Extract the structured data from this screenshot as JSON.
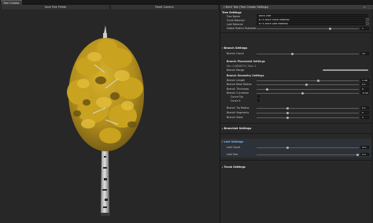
{
  "window": {
    "tab_title": "Tree Creator"
  },
  "viewport": {
    "save_button": "Save Tree Prefab",
    "reset_button": "Reset Camera"
  },
  "inspector": {
    "header_title": "Birch Tree (Tree Creator Settings)",
    "tree_settings": {
      "title": "Tree Settings",
      "tree_name_label": "Tree Name",
      "tree_name_value": "Birch Tree",
      "trunk_material_label": "Trunk Material",
      "trunk_material_value": "TS Birch Trunk Material",
      "leaf_material_label": "Leaf Material",
      "leaf_material_value": "TS Birch Leaf Material",
      "global_radius_label": "Global Radius Multiplier",
      "global_radius_value": "1"
    },
    "branch_settings": {
      "title": "Branch Settings",
      "branch_count_label": "Branch Count",
      "branch_count_value": "10",
      "placement_title": "Branch Placement Settings",
      "placement_info": "Min: 0.0838973 | Max: 1",
      "branch_range_label": "Branch Range",
      "geometry_title": "Branch Geometry Settings",
      "branch_length_label": "Branch Length",
      "branch_length_value": "1.46",
      "branch_base_radius_label": "Branch Base Radius",
      "branch_base_radius_value": "0.1",
      "branch_thickness_label": "Branch Thickness",
      "branch_thickness_value": "0",
      "branch_curvature_label": "Branch Curvature",
      "branch_curvature_value": "-0.093",
      "curve_flip_label": "Curve Flip",
      "curve_x_label": "Curve X",
      "branch_tip_radius_label": "Branch Tip Radius",
      "branch_tip_radius_value": "0.1",
      "branch_segments_label": "Branch Segments",
      "branch_segments_value": "5",
      "branch_sides_label": "Branch Sides",
      "branch_sides_value": "3"
    },
    "branchlet_settings": {
      "title": "Branchlet Settings"
    },
    "leaf_settings": {
      "title": "Leaf Settings",
      "leaf_count_label": "Leaf Count",
      "leaf_count_value": "311",
      "leaf_size_label": "Leaf Size",
      "leaf_size_value": "0.5"
    },
    "trunk_settings": {
      "title": "Trunk Settings"
    }
  },
  "slider_levels": {
    "global_radius": 0.72,
    "branch_count": 0.35,
    "branch_length": 0.6,
    "branch_base_radius": 0.49,
    "branch_thickness": 0.1,
    "branch_curvature": 0.45,
    "branch_tip_radius": 0.3,
    "branch_segments": 0.3,
    "branch_sides": 0.3,
    "leaf_count": 0.3,
    "leaf_size": 0.99
  },
  "colors": {
    "leaf_gold": "#c9a21f",
    "leaf_shadow": "#7a6318",
    "bark_white": "#d8d8d8",
    "bark_dark": "#2b2b2b",
    "accent_blue": "#5fa3d8",
    "leaf_settings_title": "#7fb3e8"
  },
  "icons": [
    "tree-creator-icon",
    "lock-icon",
    "menu-icon",
    "object-picker-icon"
  ]
}
